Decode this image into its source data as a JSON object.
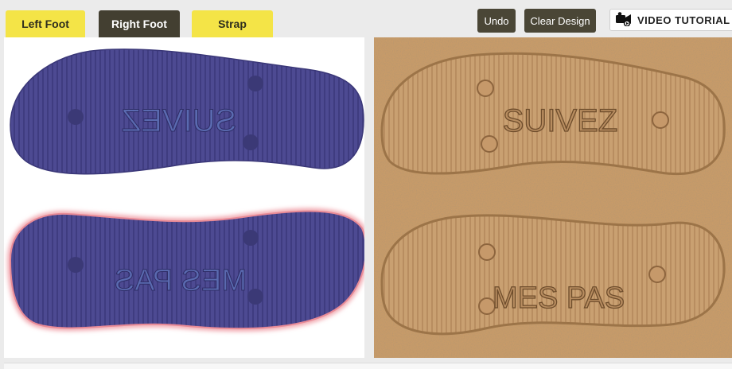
{
  "tabs": {
    "left_foot": "Left Foot",
    "right_foot": "Right Foot",
    "strap": "Strap"
  },
  "toolbar": {
    "undo": "Undo",
    "clear_design": "Clear Design",
    "video_tutorial": "VIDEO TUTORIAL"
  },
  "editor": {
    "top_sole_text": "SUIVEZ",
    "bottom_sole_text": "MES PAS",
    "sole_color": "#4d4a92",
    "selected_outline_color": "#f0a0a8"
  },
  "preview": {
    "top_imprint_text": "SUIVEZ",
    "bottom_imprint_text": "MES PAS",
    "sand_color": "#c99b68"
  },
  "colors": {
    "tab_yellow": "#f4e447",
    "tab_active": "#433f31",
    "button_dark": "#4a4636"
  }
}
